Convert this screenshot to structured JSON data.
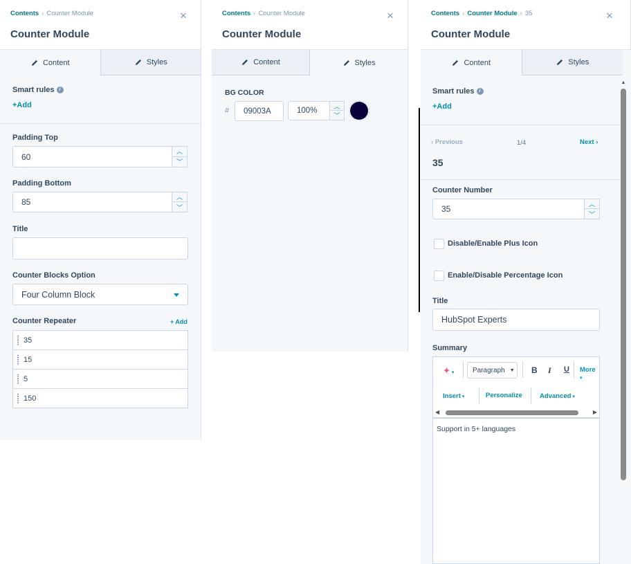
{
  "colors": {
    "accent": "#0091ae",
    "link": "#007a8c",
    "text": "#33475b",
    "panel_bg": "#f5f8fa",
    "swatch": "#09003A"
  },
  "icons": [
    "pencil-icon",
    "close-icon",
    "info-icon",
    "chevron-up-icon",
    "chevron-down-icon",
    "caret-down-icon",
    "drag-handle-icon",
    "chevron-left-icon",
    "chevron-right-icon"
  ],
  "panel1": {
    "breadcrumb": {
      "root": "Contents",
      "current": "Counter Module"
    },
    "title": "Counter Module",
    "close": "×",
    "tabs": {
      "content": "Content",
      "styles": "Styles"
    },
    "smart_rules": {
      "label": "Smart rules",
      "add": "+Add"
    },
    "padding_top": {
      "label": "Padding Top",
      "value": "60"
    },
    "padding_bottom": {
      "label": "Padding Bottom",
      "value": "85"
    },
    "title_field": {
      "label": "Title",
      "value": ""
    },
    "blocks_option": {
      "label": "Counter Blocks Option",
      "value": "Four Column Block"
    },
    "repeater": {
      "label": "Counter Repeater",
      "add": "+ Add",
      "items": [
        "35",
        "15",
        "5",
        "150"
      ]
    }
  },
  "panel2": {
    "breadcrumb": {
      "root": "Contents",
      "current": "Counter Module"
    },
    "title": "Counter Module",
    "close": "×",
    "tabs": {
      "content": "Content",
      "styles": "Styles"
    },
    "bg_color": {
      "label": "BG COLOR",
      "hash": "#",
      "hex": "09003A",
      "opacity": "100%"
    }
  },
  "panel3": {
    "breadcrumb": {
      "root": "Contents",
      "middle": "Counter Module",
      "current": "35"
    },
    "title": "Counter Module",
    "close": "×",
    "tabs": {
      "content": "Content",
      "styles": "Styles"
    },
    "smart_rules": {
      "label": "Smart rules",
      "add": "+Add"
    },
    "pager": {
      "previous": "Previous",
      "position": "1/4",
      "next": "Next"
    },
    "item_title": "35",
    "counter_number": {
      "label": "Counter Number",
      "value": "35"
    },
    "plus_icon": {
      "label": "Disable/Enable Plus Icon",
      "checked": false
    },
    "percentage_icon": {
      "label": "Enable/Disable Percentage Icon",
      "checked": false
    },
    "title_field": {
      "label": "Title",
      "value": "HubSpot Experts"
    },
    "summary": {
      "label": "Summary",
      "toolbar": {
        "paragraph": "Paragraph",
        "bold": "B",
        "italic": "I",
        "underline": "U",
        "more": "More",
        "insert": "Insert",
        "personalize": "Personalize",
        "advanced": "Advanced"
      },
      "text": "Support in 5+ languages"
    }
  }
}
